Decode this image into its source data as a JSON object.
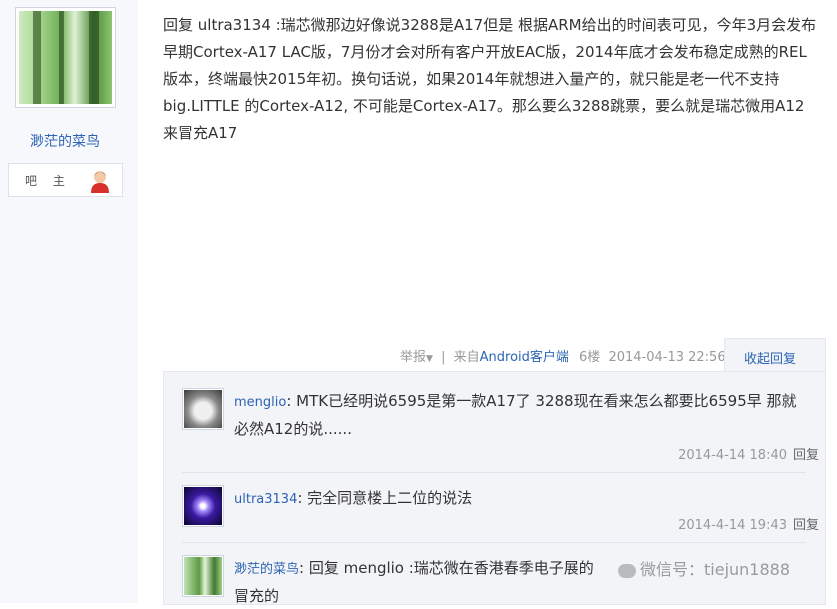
{
  "author": {
    "name": "渺茫的菜鸟",
    "role_label": "吧 主"
  },
  "post": {
    "text": "回复 ultra3134 :瑞芯微那边好像说3288是A17但是 根据ARM给出的时间表可见，今年3月会发布早期Cortex-A17 LAC版，7月份才会对所有客户开放EAC版，2014年底才会发布稳定成熟的REL版本，终端最快2015年初。换句话说，如果2014年就想进入量产的，就只能是老一代不支持big.LITTLE 的Cortex-A12, 不可能是Cortex-A17。那么要么3288跳票，要么就是瑞芯微用A12来冒充A17",
    "meta": {
      "report": "举报",
      "separator": "|",
      "from_prefix": "来自",
      "client": "Android客户端",
      "floor": "6楼",
      "datetime": "2014-04-13 22:56",
      "collapse_label": "收起回复"
    }
  },
  "replies": [
    {
      "user": "menglio",
      "text": ": MTK已经明说6595是第一款A17了 3288现在看来怎么都要比6595早 那就必然A12的说......",
      "time": "2014-4-14 18:40",
      "reply_label": "回复",
      "avatar": "kitten-photo"
    },
    {
      "user": "ultra3134",
      "text": ": 完全同意楼上二位的说法",
      "time": "2014-4-14 19:43",
      "reply_label": "回复",
      "avatar": "purple-burst"
    },
    {
      "user": "渺茫的菜鸟",
      "text": ": 回复 menglio :瑞芯微在香港春季电子展的",
      "text_cont": "冒充的",
      "avatar": "forest-photo"
    }
  ],
  "watermark": "微信号：tiejun1888",
  "colors": {
    "link": "#2d64b3",
    "sidebar_bg": "#f6f8fc",
    "reply_bg": "#f2f4f8",
    "meta": "#999999"
  }
}
